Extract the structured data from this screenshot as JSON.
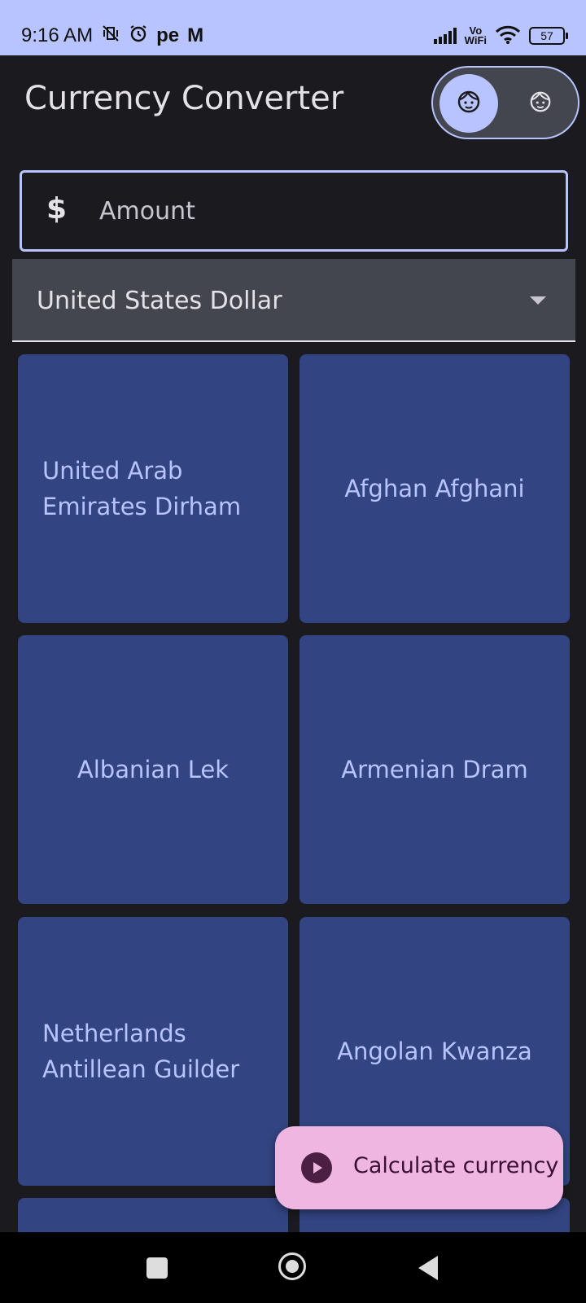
{
  "status_bar": {
    "time": "9:16 AM",
    "indicators": [
      "mute-vibrate-icon",
      "alarm-icon",
      "pe",
      "M"
    ],
    "vowifi_top": "Vo",
    "vowifi_bottom": "WiFi",
    "battery": "57"
  },
  "app": {
    "title": "Currency Converter",
    "theme_toggle": {
      "on_icon": "face-icon",
      "off_icon": "face-icon"
    }
  },
  "amount": {
    "icon": "dollar-icon",
    "placeholder": "Amount"
  },
  "base_currency": {
    "selected": "United States Dollar"
  },
  "currencies": [
    {
      "label": "United Arab Emirates Dirham"
    },
    {
      "label": "Afghan Afghani"
    },
    {
      "label": "Albanian Lek"
    },
    {
      "label": "Armenian Dram"
    },
    {
      "label": "Netherlands Antillean Guilder"
    },
    {
      "label": "Angolan Kwanza"
    }
  ],
  "fab": {
    "label": "Calculate currency",
    "icon": "play-icon"
  },
  "colors": {
    "primary": "#b8c4ff",
    "card": "#324481",
    "fab": "#f0b6e2",
    "background": "#1b1b1f"
  }
}
